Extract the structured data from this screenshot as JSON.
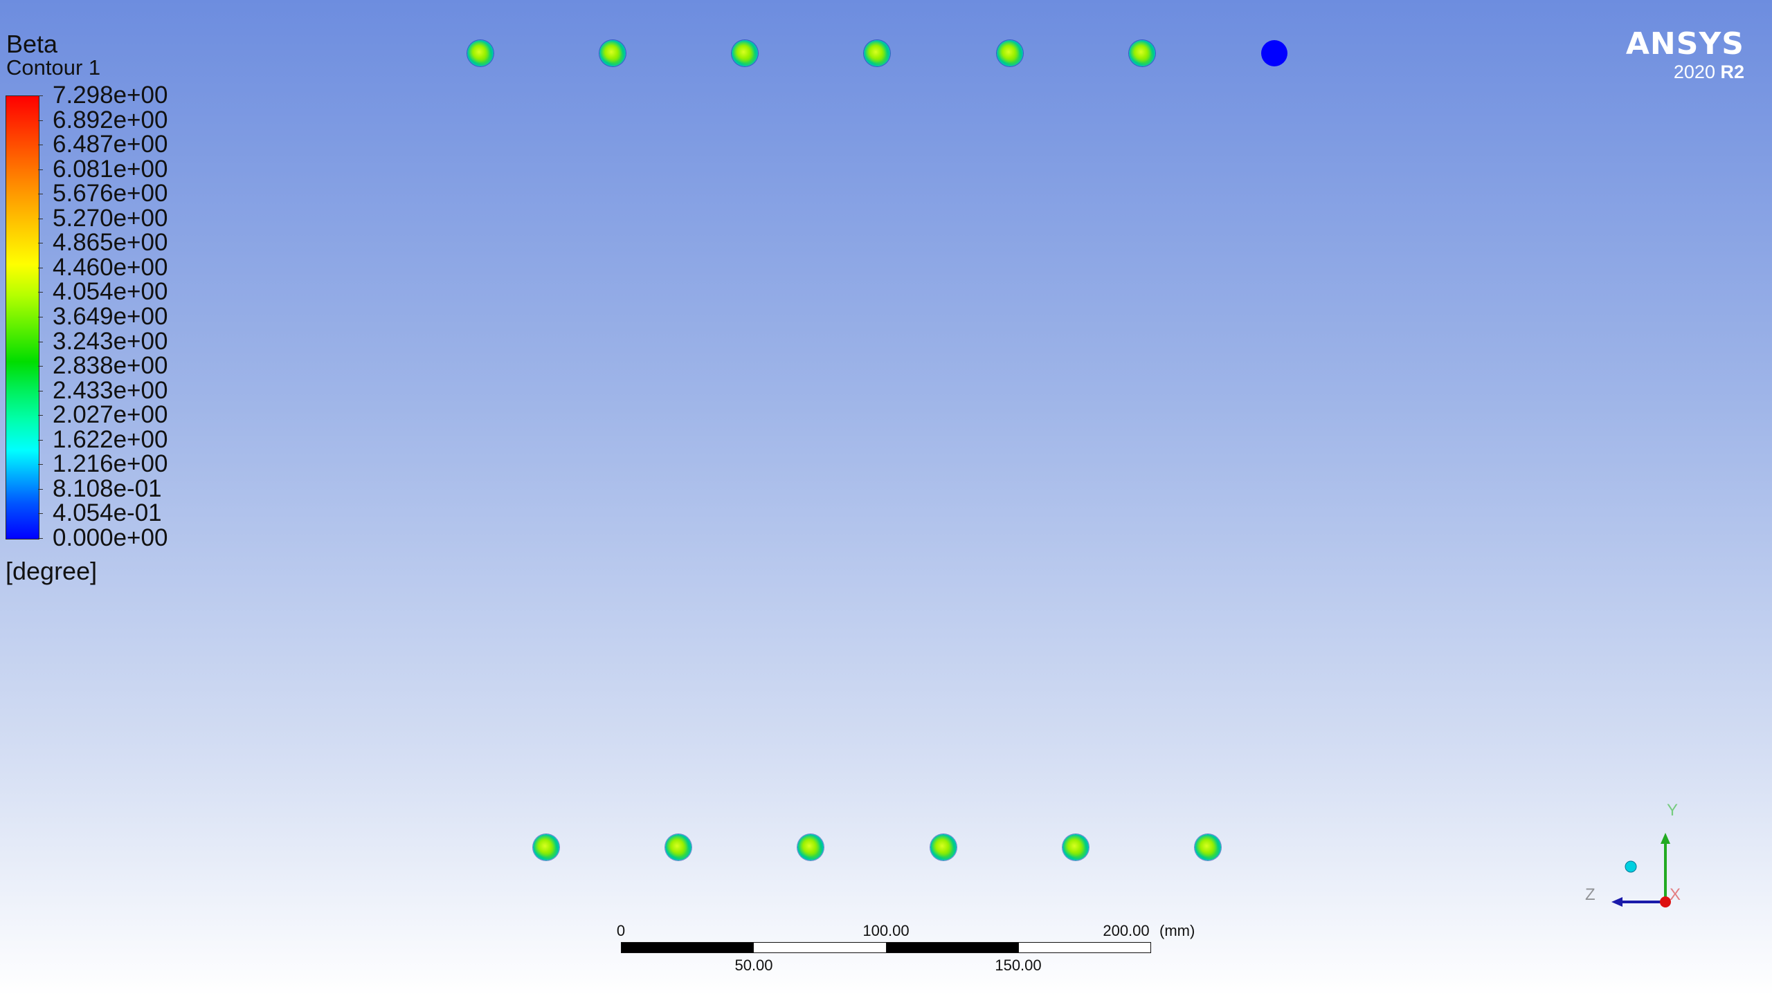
{
  "legend": {
    "title": "Beta",
    "subtitle": "Contour 1",
    "labels": [
      "7.298e+00",
      "6.892e+00",
      "6.487e+00",
      "6.081e+00",
      "5.676e+00",
      "5.270e+00",
      "4.865e+00",
      "4.460e+00",
      "4.054e+00",
      "3.649e+00",
      "3.243e+00",
      "2.838e+00",
      "2.433e+00",
      "2.027e+00",
      "1.622e+00",
      "1.216e+00",
      "8.108e-01",
      "4.054e-01",
      "0.000e+00"
    ],
    "unit": "[degree]",
    "colormap_low": "#0000ff",
    "colormap_high": "#ff0000"
  },
  "logo": {
    "brand": "ANSYS",
    "version_year": "2020",
    "version_release": "R2"
  },
  "scale_bar": {
    "top_labels": [
      "0",
      "100.00",
      "200.00"
    ],
    "unit": "(mm)",
    "bottom_labels": [
      "50.00",
      "150.00"
    ]
  },
  "triad": {
    "y_label": "Y",
    "z_label": "Z",
    "x_label": "X",
    "y_color": "#22aa22",
    "z_color": "#1a1aaa",
    "x_color": "#dd1111"
  },
  "cylinders": {
    "top_row_count": 7,
    "bottom_row_count": 6,
    "uniform_color": "#0000ff"
  },
  "background": {
    "top_color": "#6d8ddf",
    "bottom_color": "#ffffff"
  }
}
